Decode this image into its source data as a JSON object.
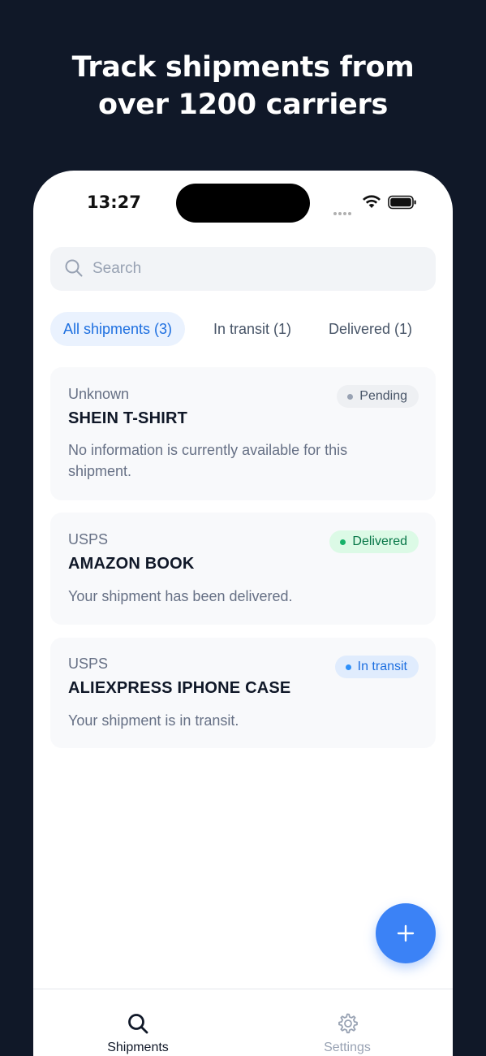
{
  "headline": {
    "line1": "Track shipments from",
    "line2": "over 1200 carriers"
  },
  "status_bar": {
    "time": "13:27",
    "icons": [
      "cellular-signal-icon",
      "wifi-icon",
      "battery-icon"
    ]
  },
  "search": {
    "placeholder": "Search",
    "value": ""
  },
  "filter_tabs": [
    {
      "label": "All shipments (3)",
      "active": true
    },
    {
      "label": "In transit (1)",
      "active": false
    },
    {
      "label": "Delivered (1)",
      "active": false
    }
  ],
  "shipments": [
    {
      "carrier": "Unknown",
      "title": "SHEIN T-SHIRT",
      "status": "Pending",
      "description": "No information is currently available for this shipment."
    },
    {
      "carrier": "USPS",
      "title": "AMAZON BOOK",
      "status": "Delivered",
      "description": "Your shipment has been delivered."
    },
    {
      "carrier": "USPS",
      "title": "ALIEXPRESS IPHONE CASE",
      "status": "In transit",
      "description": "Your shipment is in transit."
    }
  ],
  "fab": {
    "icon": "plus-icon"
  },
  "tab_bar": [
    {
      "label": "Shipments",
      "icon": "search-icon",
      "active": true
    },
    {
      "label": "Settings",
      "icon": "gear-icon",
      "active": false
    }
  ],
  "colors": {
    "background": "#101828",
    "accent": "#3b82f6",
    "pending": "#98a2b3",
    "delivered": "#17b26a",
    "in_transit": "#2e90fa"
  }
}
